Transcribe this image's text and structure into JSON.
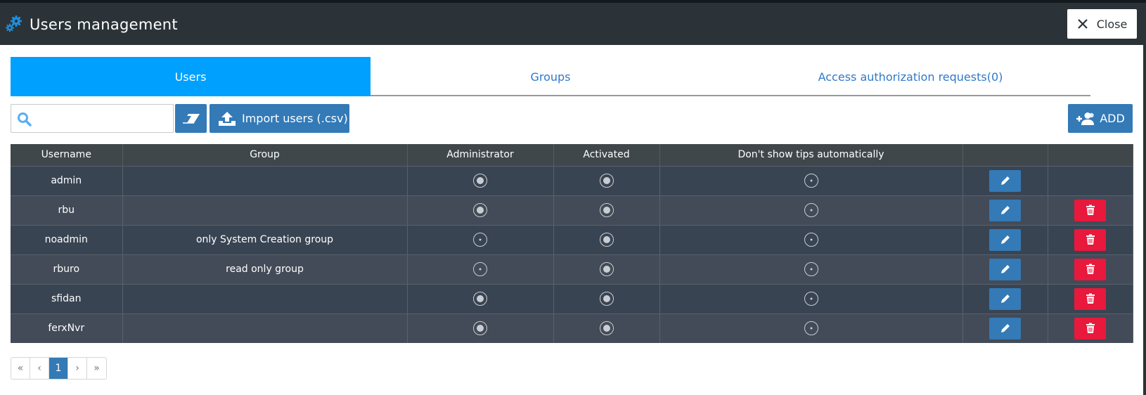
{
  "header": {
    "title": "Users management",
    "gear_icon": "gears-icon",
    "close_label": "Close"
  },
  "tabs": [
    {
      "label": "Users",
      "active": true
    },
    {
      "label": "Groups",
      "active": false
    },
    {
      "label": "Access authorization requests(0)",
      "active": false
    }
  ],
  "toolbar": {
    "search_value": "",
    "search_placeholder": "",
    "import_label": "Import users (.csv)",
    "add_label": "ADD"
  },
  "table": {
    "columns": [
      "Username",
      "Group",
      "Administrator",
      "Activated",
      "Don't show tips automatically",
      "",
      ""
    ],
    "rows": [
      {
        "username": "admin",
        "group": "",
        "administrator": true,
        "activated": true,
        "dont_show_tips": false,
        "deletable": false
      },
      {
        "username": "rbu",
        "group": "",
        "administrator": true,
        "activated": true,
        "dont_show_tips": false,
        "deletable": true
      },
      {
        "username": "noadmin",
        "group": "only System Creation group",
        "administrator": false,
        "activated": true,
        "dont_show_tips": false,
        "deletable": true
      },
      {
        "username": "rburo",
        "group": "read only group",
        "administrator": false,
        "activated": true,
        "dont_show_tips": false,
        "deletable": true
      },
      {
        "username": "sfidan",
        "group": "",
        "administrator": true,
        "activated": true,
        "dont_show_tips": false,
        "deletable": true
      },
      {
        "username": "ferxNvr",
        "group": "",
        "administrator": true,
        "activated": true,
        "dont_show_tips": false,
        "deletable": true
      }
    ]
  },
  "pagination": {
    "first": "«",
    "prev": "‹",
    "current": "1",
    "next": "›",
    "last": "»"
  },
  "colors": {
    "header_bg": "#2b3338",
    "active_tab": "#00a0ff",
    "primary_button": "#337ab7",
    "danger_button": "#e8193c",
    "row_dark": "#394453",
    "row_light": "#424b57"
  }
}
